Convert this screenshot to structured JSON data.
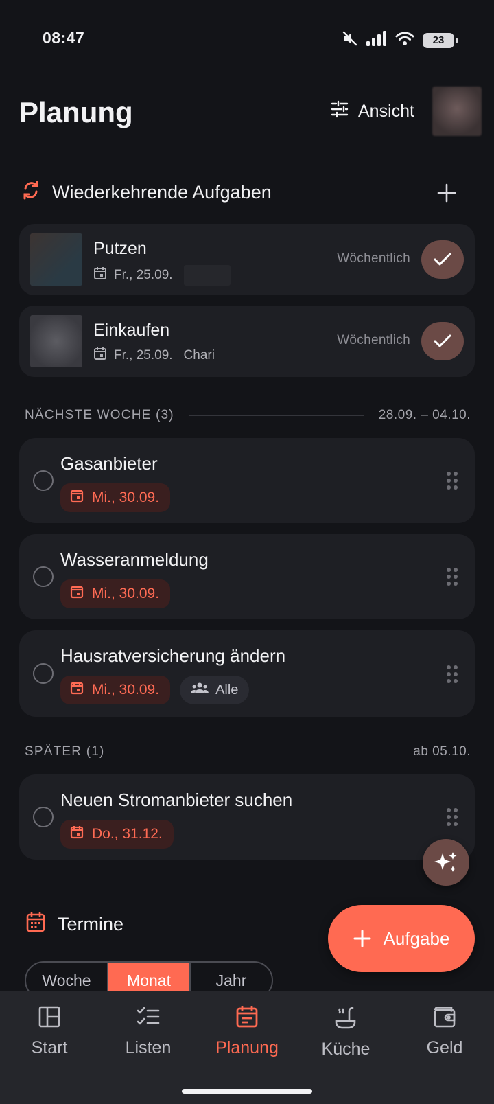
{
  "status": {
    "time": "08:47",
    "battery": "23"
  },
  "header": {
    "title": "Planung",
    "view_label": "Ansicht"
  },
  "recurring": {
    "title": "Wiederkehrende Aufgaben",
    "items": [
      {
        "name": "Putzen",
        "date": "Fr., 25.09.",
        "assignee": "",
        "frequency": "Wöchentlich"
      },
      {
        "name": "Einkaufen",
        "date": "Fr., 25.09.",
        "assignee": "Chari",
        "frequency": "Wöchentlich"
      }
    ]
  },
  "next_week": {
    "label": "NÄCHSTE WOCHE (3)",
    "range": "28.09. – 04.10.",
    "tasks": [
      {
        "title": "Gasanbieter",
        "date": "Mi., 30.09."
      },
      {
        "title": "Wasseranmeldung",
        "date": "Mi., 30.09."
      },
      {
        "title": "Hausratversicherung ändern",
        "date": "Mi., 30.09.",
        "assignee": "Alle"
      }
    ]
  },
  "later": {
    "label": "SPÄTER (1)",
    "range": "ab 05.10.",
    "tasks": [
      {
        "title": "Neuen Stromanbieter suchen",
        "date": "Do., 31.12."
      }
    ]
  },
  "appointments": {
    "title": "Termine",
    "segments": [
      "Woche",
      "Monat",
      "Jahr"
    ],
    "active_segment": "Monat"
  },
  "fab": {
    "label": "Aufgabe"
  },
  "nav": {
    "items": [
      "Start",
      "Listen",
      "Planung",
      "Küche",
      "Geld"
    ],
    "active": "Planung"
  },
  "colors": {
    "accent": "#ff6a52",
    "background": "#131418",
    "card": "#1e1f24",
    "check": "#6b4a46"
  }
}
